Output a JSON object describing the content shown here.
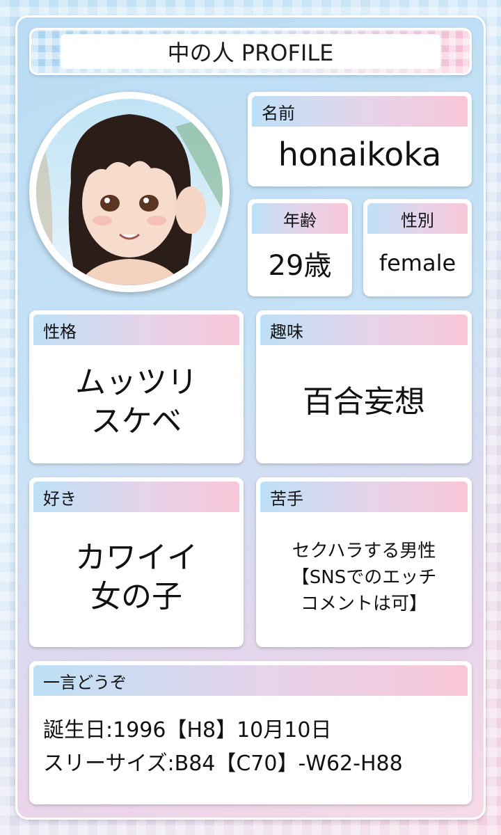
{
  "title": "中の人 PROFILE",
  "name": {
    "label": "名前",
    "value": "honaikoka"
  },
  "age": {
    "label": "年齢",
    "value": "29歳"
  },
  "gender": {
    "label": "性別",
    "value": "female"
  },
  "personality": {
    "label": "性格",
    "lines": [
      "ムッツリ",
      "スケベ"
    ]
  },
  "hobby": {
    "label": "趣味",
    "value": "百合妄想"
  },
  "likes": {
    "label": "好き",
    "lines": [
      "カワイイ",
      "女の子"
    ]
  },
  "dislikes": {
    "label": "苦手",
    "lines": [
      "セクハラする男性",
      "【SNSでのエッチ",
      "コメントは可】"
    ]
  },
  "comment": {
    "label": "一言どうぞ",
    "lines": [
      "誕生日:1996【H8】10月10日",
      "スリーサイズ:B84【C70】-W62-H88"
    ]
  },
  "colors": {
    "blue": "#bde0f6",
    "pink": "#f8c6d8",
    "frame": "#c8e2f6"
  }
}
